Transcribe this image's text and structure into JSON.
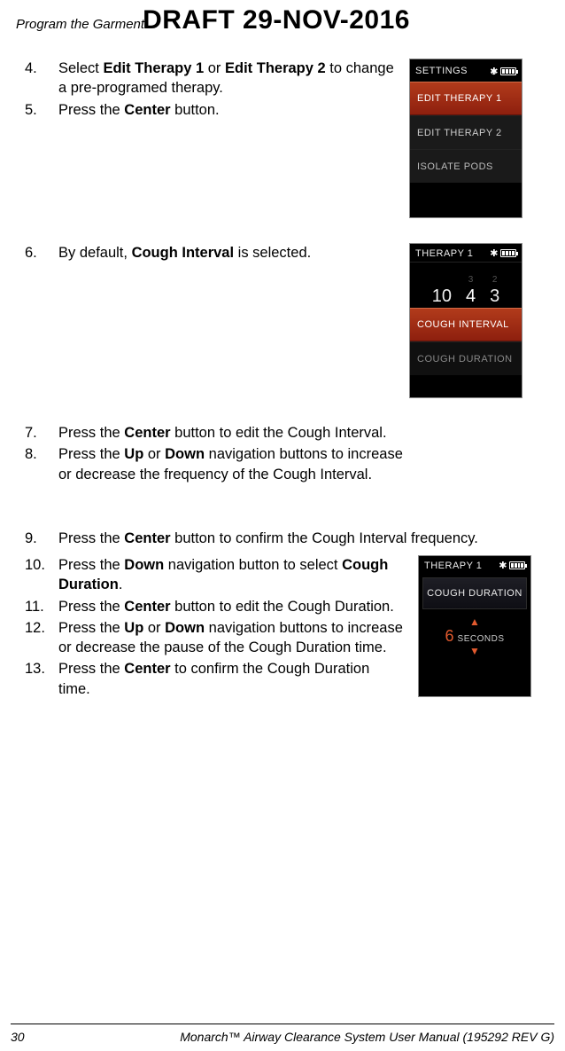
{
  "header": {
    "chapter": "Program the Garment",
    "draft": "DRAFT 29-NOV-2016"
  },
  "steps": {
    "s4": {
      "n": "4.",
      "pre": "Select ",
      "b1": "Edit Therapy 1",
      "mid": " or ",
      "b2": "Edit Therapy 2",
      "post": " to change a pre-programed therapy."
    },
    "s5": {
      "n": "5.",
      "pre": "Press the ",
      "b1": "Center",
      "post": " button."
    },
    "s6": {
      "n": "6.",
      "pre": "By default, ",
      "b1": "Cough Interval",
      "post": " is selected."
    },
    "s7": {
      "n": "7.",
      "pre": "Press the ",
      "b1": "Center",
      "post": " button to edit the Cough Interval."
    },
    "s8": {
      "n": "8.",
      "pre": "Press the ",
      "b1": "Up",
      "mid": " or ",
      "b2": "Down",
      "post": " navigation buttons to increase or decrease the frequency of the Cough Interval."
    },
    "s9": {
      "n": "9.",
      "pre": "Press the ",
      "b1": "Center",
      "post": " button to confirm the Cough Interval frequency."
    },
    "s10": {
      "n": "10.",
      "pre": "Press the ",
      "b1": "Down",
      "mid": " navigation button to select ",
      "b2": "Cough Duration",
      "post": "."
    },
    "s11": {
      "n": "11.",
      "pre": "Press the ",
      "b1": "Center",
      "post": " button to edit the Cough Duration."
    },
    "s12": {
      "n": "12.",
      "pre": "Press the ",
      "b1": "Up",
      "mid": " or ",
      "b2": "Down",
      "post": " navigation buttons to increase or decrease the pause of the Cough Duration time."
    },
    "s13": {
      "n": "13.",
      "pre": "Press the ",
      "b1": "Center",
      "post": " to confirm the Cough Duration time."
    }
  },
  "screens": {
    "settings": {
      "title": "SETTINGS",
      "items": [
        "EDIT THERAPY 1",
        "EDIT THERAPY 2",
        "ISOLATE PODS"
      ],
      "selected_index": 0
    },
    "therapy1": {
      "title": "THERAPY 1",
      "wheel_top": [
        "",
        "3",
        "2"
      ],
      "wheel_vals": [
        "10",
        "4",
        "3"
      ],
      "items": [
        "COUGH INTERVAL",
        "COUGH DURATION"
      ],
      "selected_index": 0
    },
    "duration": {
      "title": "THERAPY 1",
      "label": "COUGH DURATION",
      "value": "6",
      "unit": "SECONDS"
    }
  },
  "footer": {
    "page": "30",
    "text": "Monarch™ Airway Clearance System User Manual (195292 REV G)"
  }
}
